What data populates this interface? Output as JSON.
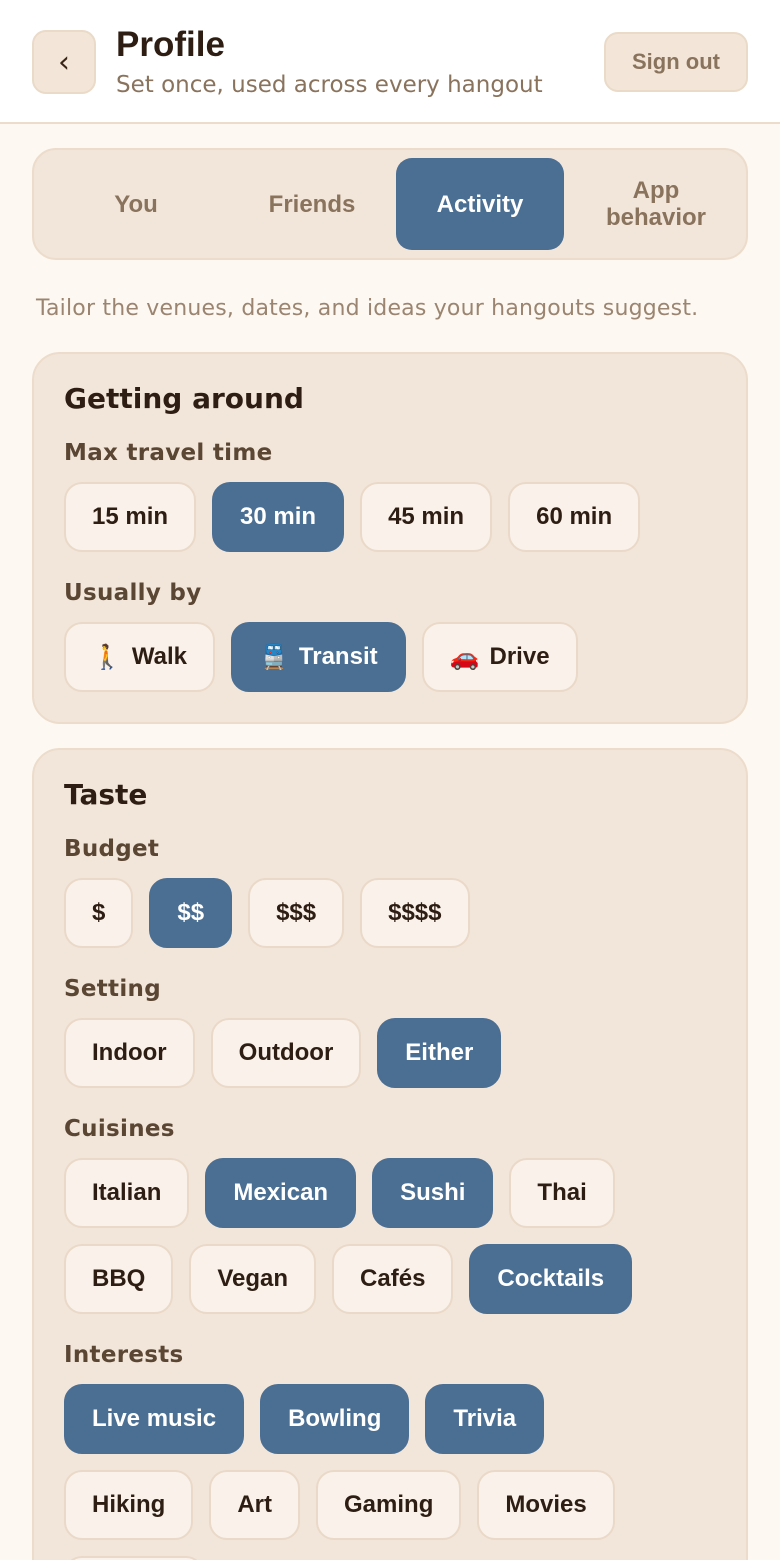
{
  "header": {
    "back_icon": "chevron-left-icon",
    "back_glyph": "‹",
    "title": "Profile",
    "subtitle": "Set once, used across every hangout",
    "signout_label": "Sign out"
  },
  "tabs": [
    {
      "label": "You",
      "active": false
    },
    {
      "label": "Friends",
      "active": false
    },
    {
      "label": "Activity",
      "active": true
    },
    {
      "label": "App behavior",
      "active": false
    }
  ],
  "intro": "Tailor the venues, dates, and ideas your hangouts suggest.",
  "getting_around": {
    "title": "Getting around",
    "max_travel_label": "Max travel time",
    "max_travel_options": [
      {
        "label": "15 min",
        "selected": false
      },
      {
        "label": "30 min",
        "selected": true
      },
      {
        "label": "45 min",
        "selected": false
      },
      {
        "label": "60 min",
        "selected": false
      }
    ],
    "usually_by_label": "Usually by",
    "usually_by_options": [
      {
        "label": "Walk",
        "icon": "walking-person-icon",
        "glyph": "🚶",
        "selected": false
      },
      {
        "label": "Transit",
        "icon": "train-icon",
        "glyph": "🚆",
        "selected": true
      },
      {
        "label": "Drive",
        "icon": "car-icon",
        "glyph": "🚗",
        "selected": false
      }
    ]
  },
  "taste": {
    "title": "Taste",
    "budget_label": "Budget",
    "budget_options": [
      {
        "label": "$",
        "selected": false
      },
      {
        "label": "$$",
        "selected": true
      },
      {
        "label": "$$$",
        "selected": false
      },
      {
        "label": "$$$$",
        "selected": false
      }
    ],
    "setting_label": "Setting",
    "setting_options": [
      {
        "label": "Indoor",
        "selected": false
      },
      {
        "label": "Outdoor",
        "selected": false
      },
      {
        "label": "Either",
        "selected": true
      }
    ],
    "cuisines_label": "Cuisines",
    "cuisines_options": [
      {
        "label": "Italian",
        "selected": false
      },
      {
        "label": "Mexican",
        "selected": true
      },
      {
        "label": "Sushi",
        "selected": true
      },
      {
        "label": "Thai",
        "selected": false
      },
      {
        "label": "BBQ",
        "selected": false
      },
      {
        "label": "Vegan",
        "selected": false
      },
      {
        "label": "Cafés",
        "selected": false
      },
      {
        "label": "Cocktails",
        "selected": true
      }
    ],
    "interests_label": "Interests",
    "interests_options": [
      {
        "label": "Live music",
        "selected": true
      },
      {
        "label": "Bowling",
        "selected": true
      },
      {
        "label": "Trivia",
        "selected": true
      },
      {
        "label": "Hiking",
        "selected": false
      },
      {
        "label": "Art",
        "selected": false
      },
      {
        "label": "Gaming",
        "selected": false
      },
      {
        "label": "Movies",
        "selected": false
      }
    ]
  },
  "colors": {
    "accent": "#4b6e93",
    "background": "#fdf8f2",
    "card": "#f2e6da",
    "chip": "#f9f1ea",
    "text": "#2d1d12",
    "muted": "#8a735d"
  }
}
